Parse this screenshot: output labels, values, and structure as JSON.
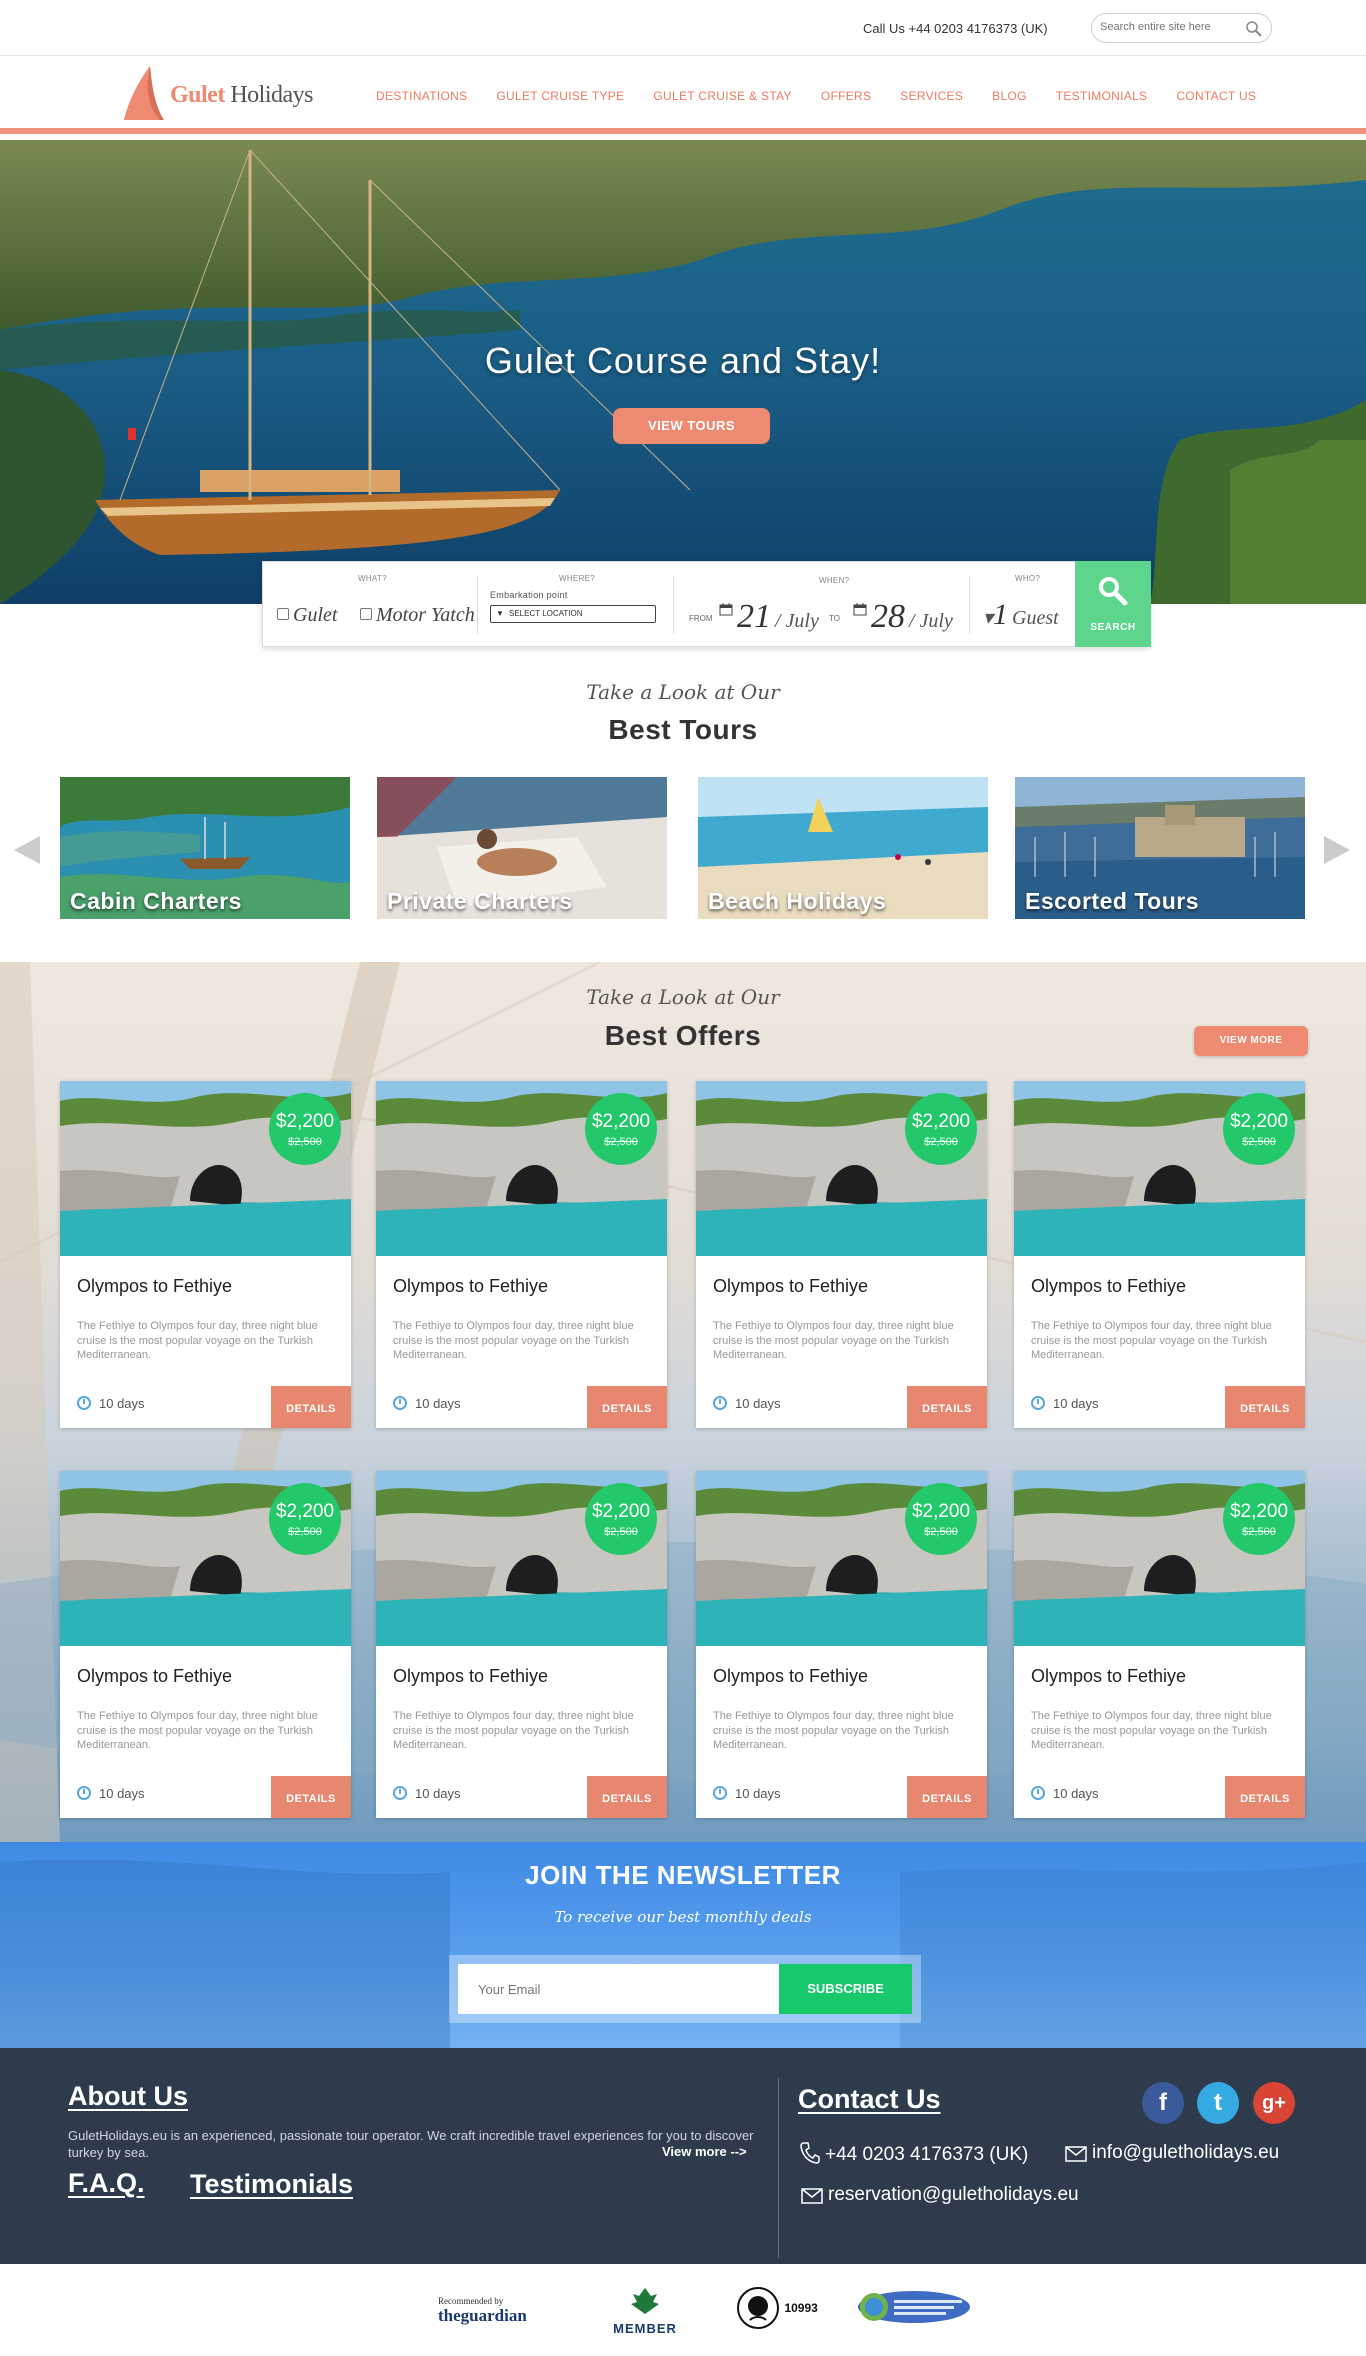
{
  "topbar": {
    "call": "Call Us +44 0203 4176373 (UK)",
    "search_placeholder": "Search entire site here"
  },
  "logo": {
    "part1": "Gulet",
    "part2": " Holidays"
  },
  "nav": [
    "DESTINATIONS",
    "GULET CRUISE TYPE",
    "GULET CRUISE & STAY",
    "OFFERS",
    "SERVICES",
    "BLOG",
    "TESTIMONIALS",
    "CONTACT US"
  ],
  "hero": {
    "title": "Gulet Course and Stay!",
    "button": "VIEW TOURS"
  },
  "booking": {
    "what_label": "WHAT?",
    "opt_gulet": "Gulet",
    "opt_motor": "Motor Yatch",
    "where_label": "WHERE?",
    "embark_label": "Embarkation point",
    "select_location": "SELECT LOCATION",
    "when_label": "WHEN?",
    "from_label": "FROM",
    "from_day": "21",
    "from_month": "/ July",
    "to_label": "TO",
    "to_day": "28",
    "to_month": "/ July",
    "who_label": "WHO?",
    "guests_prefix": "▾",
    "guests_count": "1",
    "guests_label": "Guest",
    "search_button": "SEARCH"
  },
  "tours_section": {
    "script": "Take a Look at Our",
    "heading": "Best Tours",
    "items": [
      "Cabin Charters",
      "Private Charters",
      "Beach Holidays",
      "Escorted Tours"
    ]
  },
  "offers_section": {
    "script": "Take a Look at Our",
    "heading": "Best Offers",
    "view_more": "VIEW MORE",
    "cards": [
      {
        "price": "$2,200",
        "old_price": "$2,500",
        "title": "Olympos to Fethiye",
        "desc": "The Fethiye to Olympos four day, three night blue cruise is the most popular voyage on the Turkish Mediterranean.",
        "days": "10 days",
        "button": "DETAILS"
      },
      {
        "price": "$2,200",
        "old_price": "$2,500",
        "title": "Olympos to Fethiye",
        "desc": "The Fethiye to Olympos four day, three night blue cruise is the most popular voyage on the Turkish Mediterranean.",
        "days": "10 days",
        "button": "DETAILS"
      },
      {
        "price": "$2,200",
        "old_price": "$2,500",
        "title": "Olympos to Fethiye",
        "desc": "The Fethiye to Olympos four day, three night blue cruise is the most popular voyage on the Turkish Mediterranean.",
        "days": "10 days",
        "button": "DETAILS"
      },
      {
        "price": "$2,200",
        "old_price": "$2,500",
        "title": "Olympos to Fethiye",
        "desc": "The Fethiye to Olympos four day, three night blue cruise is the most popular voyage on the Turkish Mediterranean.",
        "days": "10 days",
        "button": "DETAILS"
      },
      {
        "price": "$2,200",
        "old_price": "$2,500",
        "title": "Olympos to Fethiye",
        "desc": "The Fethiye to Olympos four day, three night blue cruise is the most popular voyage on the Turkish Mediterranean.",
        "days": "10 days",
        "button": "DETAILS"
      },
      {
        "price": "$2,200",
        "old_price": "$2,500",
        "title": "Olympos to Fethiye",
        "desc": "The Fethiye to Olympos four day, three night blue cruise is the most popular voyage on the Turkish Mediterranean.",
        "days": "10 days",
        "button": "DETAILS"
      },
      {
        "price": "$2,200",
        "old_price": "$2,500",
        "title": "Olympos to Fethiye",
        "desc": "The Fethiye to Olympos four day, three night blue cruise is the most popular voyage on the Turkish Mediterranean.",
        "days": "10 days",
        "button": "DETAILS"
      },
      {
        "price": "$2,200",
        "old_price": "$2,500",
        "title": "Olympos to Fethiye",
        "desc": "The Fethiye to Olympos four day, three night blue cruise is the most popular voyage on the Turkish Mediterranean.",
        "days": "10 days",
        "button": "DETAILS"
      }
    ]
  },
  "newsletter": {
    "heading": "JOIN THE NEWSLETTER",
    "sub": "To receive our best monthly deals",
    "placeholder": "Your Email",
    "button": "SUBSCRIBE"
  },
  "footer": {
    "about_heading": "About Us",
    "about_text": "GuletHolidays.eu is an experienced, passionate tour operator. We craft incredible travel experiences for you to discover turkey by sea.",
    "view_more": "View more -->",
    "faq": "F.A.Q.",
    "testimonials": "Testimonials",
    "contact_heading": "Contact Us",
    "phone": "+44 0203 4176373 (UK)",
    "email1": "info@guletholidays.eu",
    "email2": "reservation@guletholidays.eu",
    "social": {
      "facebook": "f",
      "twitter": "t",
      "google": "g+"
    }
  },
  "partners": {
    "guardian_small": "Recommended by",
    "guardian_the": "the",
    "guardian_name": "guardian",
    "ecotourism": "MEMBER",
    "atol_number": "10993"
  },
  "colors": {
    "accent": "#ee8a72",
    "green": "#22c86a",
    "newsletter_blue": "#4a93ea",
    "footer": "#2e3b4d"
  }
}
